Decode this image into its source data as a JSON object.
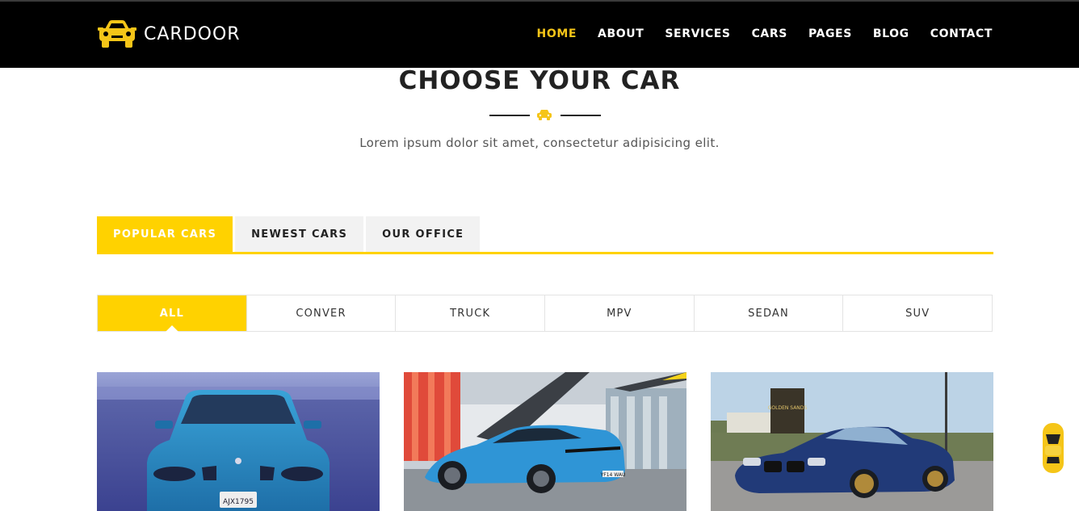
{
  "header": {
    "logo_text": "CARDOOR",
    "logo_icon": "car-front-icon",
    "nav": [
      {
        "label": "HOME",
        "active": true
      },
      {
        "label": "ABOUT",
        "active": false
      },
      {
        "label": "SERVICES",
        "active": false
      },
      {
        "label": "CARS",
        "active": false
      },
      {
        "label": "PAGES",
        "active": false
      },
      {
        "label": "BLOG",
        "active": false
      },
      {
        "label": "CONTACT",
        "active": false
      }
    ]
  },
  "section": {
    "title": "CHOOSE YOUR CAR",
    "subtitle": "Lorem ipsum dolor sit amet, consectetur adipisicing elit."
  },
  "tabs": [
    {
      "label": "POPULAR CARS",
      "active": true
    },
    {
      "label": "NEWEST CARS",
      "active": false
    },
    {
      "label": "OUR OFFICE",
      "active": false
    }
  ],
  "filters": [
    {
      "label": "ALL",
      "active": true
    },
    {
      "label": "CONVER",
      "active": false
    },
    {
      "label": "TRUCK",
      "active": false
    },
    {
      "label": "MPV",
      "active": false
    },
    {
      "label": "SEDAN",
      "active": false
    },
    {
      "label": "SUV",
      "active": false
    }
  ],
  "cards": [
    {
      "image": "blue-bmw-sedan-front-photo",
      "plate": "AJX1795"
    },
    {
      "image": "blue-bmw-i8-photo",
      "plate": "YF14 WAU"
    },
    {
      "image": "dark-blue-bmw-coupe-photo",
      "sign": "GOLDEN SANDS"
    }
  ],
  "colors": {
    "accent": "#ffd200",
    "header_bg": "#000000",
    "text": "#222222"
  }
}
